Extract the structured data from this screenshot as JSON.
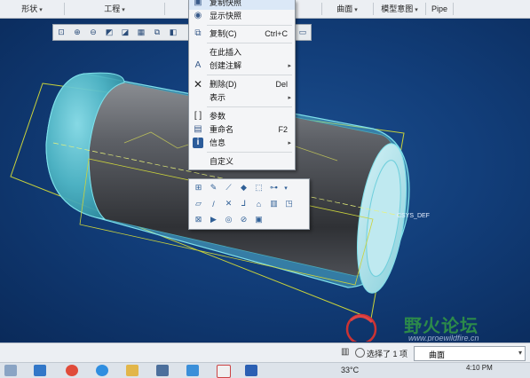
{
  "ribbon": {
    "groups": [
      "形状",
      "工程",
      "曲面",
      "模型意图",
      "Pipe"
    ]
  },
  "context_menu": {
    "items": [
      {
        "label": "复制快照",
        "shortcut": "",
        "submenu": false,
        "icon": "snapshot-icon"
      },
      {
        "label": "显示快照",
        "shortcut": "",
        "submenu": false,
        "icon": "show-snapshot-icon"
      },
      {
        "label": "复制(C)",
        "shortcut": "Ctrl+C",
        "submenu": false,
        "icon": "copy-icon"
      },
      {
        "label": "在此插入",
        "shortcut": "",
        "submenu": false,
        "icon": ""
      },
      {
        "label": "创建注解",
        "shortcut": "",
        "submenu": true,
        "icon": "annotation-icon"
      },
      {
        "label": "删除(D)",
        "shortcut": "Del",
        "submenu": false,
        "icon": "delete-icon"
      },
      {
        "label": "表示",
        "shortcut": "",
        "submenu": true,
        "icon": ""
      },
      {
        "label": "参数",
        "shortcut": "",
        "submenu": false,
        "icon": "parameters-icon"
      },
      {
        "label": "重命名",
        "shortcut": "F2",
        "submenu": false,
        "icon": "rename-icon"
      },
      {
        "label": "信息",
        "shortcut": "",
        "submenu": true,
        "icon": "info-icon"
      },
      {
        "label": "自定义",
        "shortcut": "",
        "submenu": false,
        "icon": ""
      }
    ]
  },
  "viewport": {
    "csys_label": "CSYS_DEF",
    "watermark_title": "野火论坛",
    "watermark_url": "www.proewildfire.cn"
  },
  "status": {
    "selection_text": "选择了 1 项",
    "filter_value": "曲面"
  },
  "taskbar": {
    "temperature": "33°C",
    "time": "4:10 PM"
  }
}
